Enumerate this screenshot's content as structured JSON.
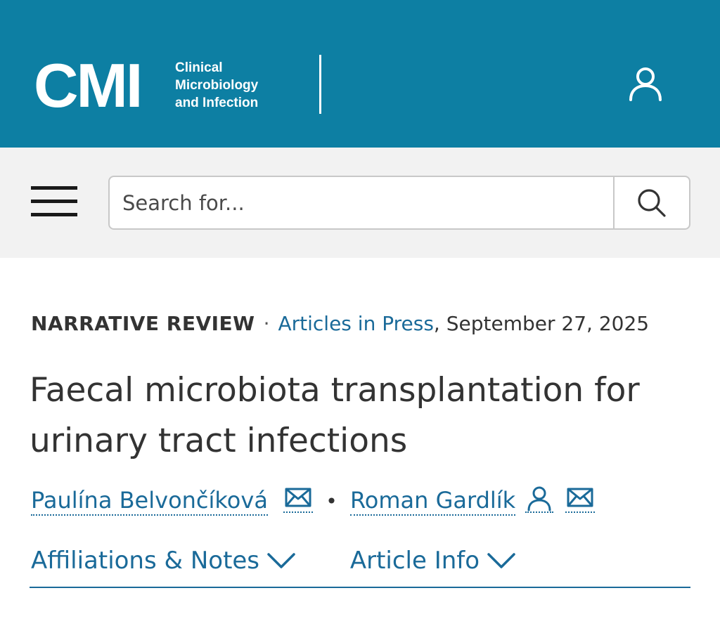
{
  "header": {
    "logo_text": "CMI",
    "journal_name_lines": [
      "Clinical",
      "Microbiology",
      "and Infection"
    ],
    "brand_color": "#0d7fa3"
  },
  "search": {
    "placeholder": "Search for...",
    "value": ""
  },
  "article": {
    "type": "NARRATIVE REVIEW",
    "separator": "·",
    "issue_link": "Articles in Press",
    "date": ", September 27, 2025",
    "title": "Faecal microbiota transplantation for urinary tract infections",
    "authors": [
      {
        "name": "Paulína Belvončíková",
        "icons": [
          "mail-icon"
        ]
      },
      {
        "name": "Roman Gardlík",
        "icons": [
          "person-icon",
          "mail-icon"
        ]
      }
    ],
    "author_separator": "•"
  },
  "accordions": {
    "affiliations_label": "Affiliations & Notes",
    "article_info_label": "Article Info"
  },
  "colors": {
    "link": "#1a6a99",
    "text": "#333333",
    "search_band": "#f2f2f2"
  }
}
